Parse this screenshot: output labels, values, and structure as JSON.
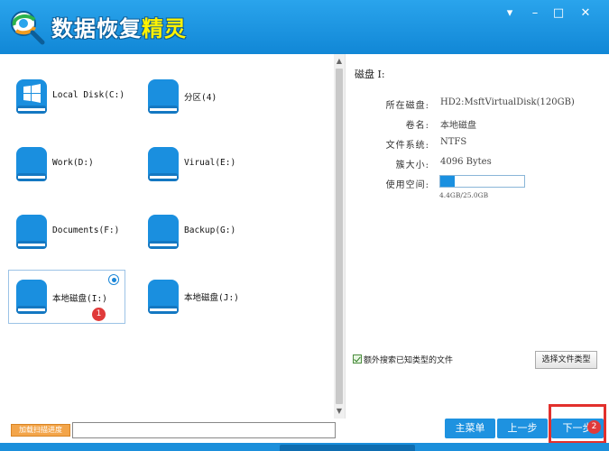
{
  "app": {
    "title_main": "数据恢复",
    "title_accent": "精灵"
  },
  "window_controls": {
    "menu": "▾",
    "minimize": "–",
    "maximize": "□",
    "close": "✕"
  },
  "drives": [
    {
      "label": "Local Disk(C:)",
      "icon": "windows-drive-icon",
      "selected": false
    },
    {
      "label": "分区(4)",
      "icon": "drive-icon",
      "selected": false
    },
    {
      "label": "Work(D:)",
      "icon": "drive-icon",
      "selected": false
    },
    {
      "label": "Virual(E:)",
      "icon": "drive-icon",
      "selected": false
    },
    {
      "label": "Documents(F:)",
      "icon": "drive-icon",
      "selected": false
    },
    {
      "label": "Backup(G:)",
      "icon": "drive-icon",
      "selected": false
    },
    {
      "label": "本地磁盘(I:)",
      "icon": "drive-icon",
      "selected": true,
      "badge": "1"
    },
    {
      "label": "本地磁盘(J:)",
      "icon": "drive-icon",
      "selected": false
    }
  ],
  "details": {
    "title": "磁盘 I:",
    "rows": [
      {
        "key": "所在磁盘:",
        "value": "HD2:MsftVirtualDisk(120GB)"
      },
      {
        "key": "卷名:",
        "value": "本地磁盘"
      },
      {
        "key": "文件系统:",
        "value": "NTFS"
      },
      {
        "key": "簇大小:",
        "value": "4096 Bytes"
      },
      {
        "key": "使用空间:",
        "value": ""
      }
    ],
    "usage_fraction": 0.176,
    "usage_text": "4.4GB/25.0GB"
  },
  "options": {
    "extra_search_label": "额外搜索已知类型的文件",
    "extra_search_checked": true,
    "select_filetype_button": "选择文件类型"
  },
  "bottom": {
    "load_progress_button": "加载扫描进度",
    "progress_value": "",
    "main_menu_button": "主菜单",
    "prev_button": "上一步",
    "next_button": "下一步",
    "next_badge": "2"
  },
  "colors": {
    "accent": "#1b8fdb",
    "badge": "#e03a3a",
    "highlight": "#e2302c"
  }
}
